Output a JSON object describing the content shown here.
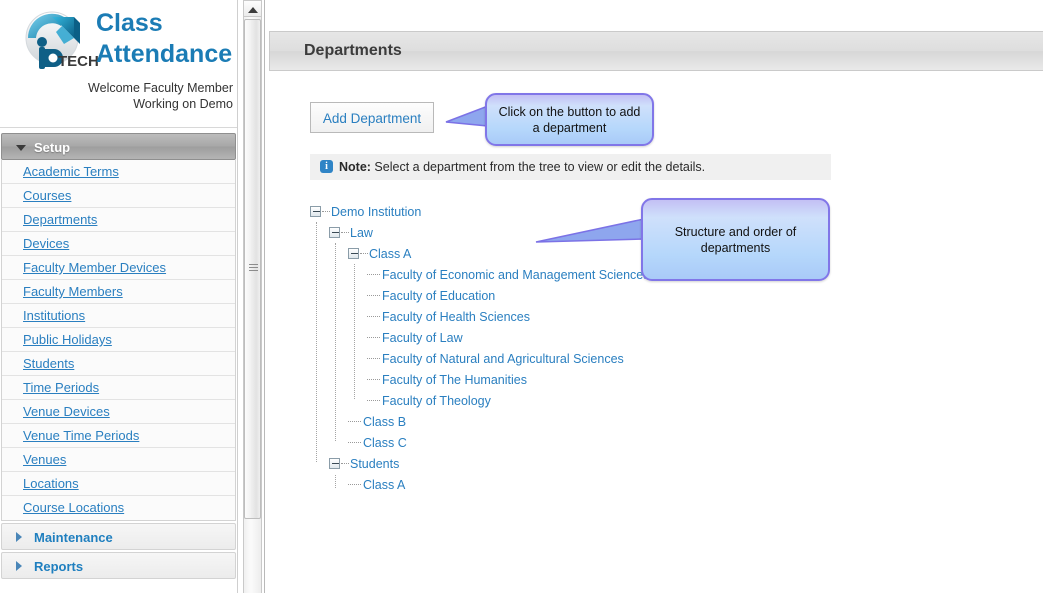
{
  "brand": {
    "logo_alt": "iP TECH logo",
    "title_line1": "Class",
    "title_line2": "Attendance",
    "welcome_line1": "Welcome Faculty Member",
    "welcome_line2": "Working on Demo",
    "title_color": "#1b7cb5"
  },
  "sidebar": {
    "groups": [
      {
        "label": "Setup",
        "expanded": true
      },
      {
        "label": "Maintenance",
        "expanded": false
      },
      {
        "label": "Reports",
        "expanded": false
      }
    ],
    "setup_items": [
      {
        "label": "Academic Terms"
      },
      {
        "label": "Courses"
      },
      {
        "label": "Departments"
      },
      {
        "label": "Devices"
      },
      {
        "label": "Faculty Member Devices"
      },
      {
        "label": "Faculty Members"
      },
      {
        "label": "Institutions"
      },
      {
        "label": "Public Holidays"
      },
      {
        "label": "Students"
      },
      {
        "label": "Time Periods"
      },
      {
        "label": "Venue Devices"
      },
      {
        "label": "Venue Time Periods"
      },
      {
        "label": "Venues"
      },
      {
        "label": "Locations"
      },
      {
        "label": "Course Locations"
      }
    ],
    "link_color": "#2a7fc0"
  },
  "scrollbar": {
    "up_arrow_icon": "caret-up-icon",
    "grip_icon": "scroll-grip-icon"
  },
  "main": {
    "page_title": "Departments",
    "add_button_label": "Add Department",
    "note": {
      "icon": "info-icon",
      "icon_glyph": "i",
      "strong": "Note:",
      "text": " Select a department from the tree to view or edit the details."
    }
  },
  "callouts": [
    {
      "id": "callout-add",
      "text": "Click on the button to add a department",
      "border_color": "#8176e8"
    },
    {
      "id": "callout-tree",
      "text": "Structure and order of departments",
      "border_color": "#8176e8"
    }
  ],
  "tree": {
    "nodes": [
      {
        "label": "Demo Institution",
        "depth": 0,
        "type": "expanded"
      },
      {
        "label": "Law",
        "depth": 1,
        "type": "expanded"
      },
      {
        "label": "Class A",
        "depth": 2,
        "type": "expanded"
      },
      {
        "label": "Faculty of Economic and Management Sciences",
        "depth": 3,
        "type": "leaf"
      },
      {
        "label": "Faculty of Education",
        "depth": 3,
        "type": "leaf"
      },
      {
        "label": "Faculty of Health Sciences",
        "depth": 3,
        "type": "leaf"
      },
      {
        "label": "Faculty of Law",
        "depth": 3,
        "type": "leaf"
      },
      {
        "label": "Faculty of Natural and Agricultural Sciences",
        "depth": 3,
        "type": "leaf"
      },
      {
        "label": "Faculty of The Humanities",
        "depth": 3,
        "type": "leaf"
      },
      {
        "label": "Faculty of Theology",
        "depth": 3,
        "type": "leaf-last"
      },
      {
        "label": "Class B",
        "depth": 2,
        "type": "leaf"
      },
      {
        "label": "Class C",
        "depth": 2,
        "type": "leaf-last"
      },
      {
        "label": "Students",
        "depth": 1,
        "type": "expanded"
      },
      {
        "label": "Class A",
        "depth": 2,
        "type": "leaf-last"
      }
    ]
  }
}
